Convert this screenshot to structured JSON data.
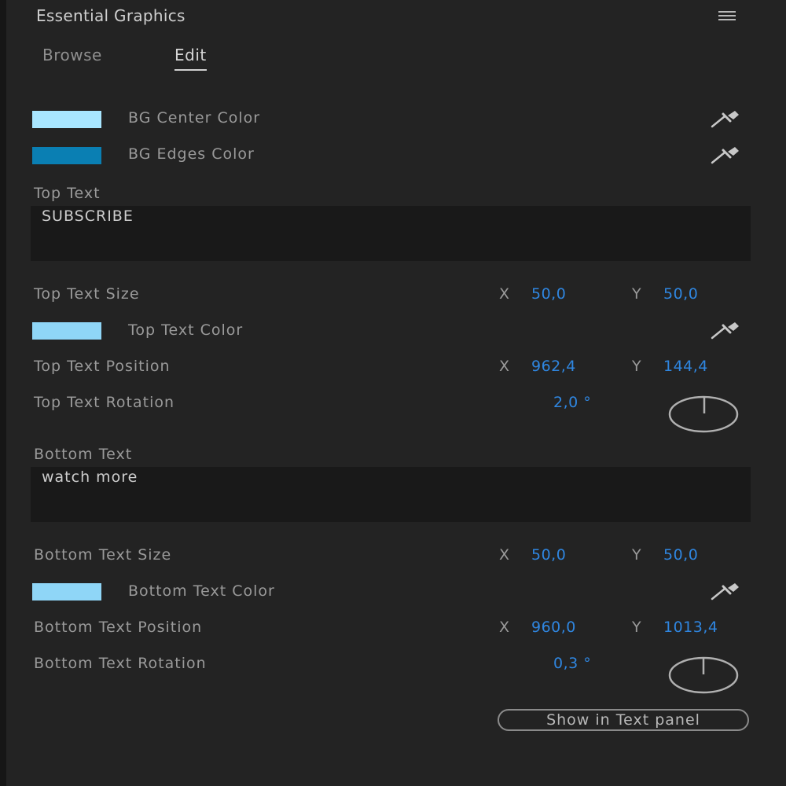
{
  "panel": {
    "title": "Essential Graphics",
    "menu_icon": "hamburger-menu-icon"
  },
  "tabs": [
    {
      "label": "Browse",
      "active": false
    },
    {
      "label": "Edit",
      "active": true
    }
  ],
  "colors": {
    "bg_center": "#a8e6ff",
    "bg_edges": "#0a7fb3",
    "top_text": "#8fd6f7",
    "bottom_text": "#8fd6f7",
    "value_blue": "#2f86e0"
  },
  "properties": {
    "bg_center_color": {
      "label": "BG Center Color",
      "icon": "eyedropper-icon"
    },
    "bg_edges_color": {
      "label": "BG Edges Color",
      "icon": "eyedropper-icon"
    },
    "top_text": {
      "label": "Top Text",
      "value": "SUBSCRIBE"
    },
    "top_text_size": {
      "label": "Top Text Size",
      "x_label": "X",
      "x": "50,0",
      "y_label": "Y",
      "y": "50,0"
    },
    "top_text_color": {
      "label": "Top Text Color",
      "icon": "eyedropper-icon"
    },
    "top_text_position": {
      "label": "Top Text Position",
      "x_label": "X",
      "x": "962,4",
      "y_label": "Y",
      "y": "144,4"
    },
    "top_text_rotation": {
      "label": "Top Text Rotation",
      "value": "2,0 °",
      "icon": "rotation-dial-icon"
    },
    "bottom_text": {
      "label": "Bottom Text",
      "value": "watch more"
    },
    "bottom_text_size": {
      "label": "Bottom Text Size",
      "x_label": "X",
      "x": "50,0",
      "y_label": "Y",
      "y": "50,0"
    },
    "bottom_text_color": {
      "label": "Bottom Text Color",
      "icon": "eyedropper-icon"
    },
    "bottom_text_position": {
      "label": "Bottom Text Position",
      "x_label": "X",
      "x": "960,0",
      "y_label": "Y",
      "y": "1013,4"
    },
    "bottom_text_rotation": {
      "label": "Bottom Text Rotation",
      "value": "0,3 °",
      "icon": "rotation-dial-icon"
    }
  },
  "buttons": {
    "show_in_text_panel": "Show in Text panel"
  }
}
